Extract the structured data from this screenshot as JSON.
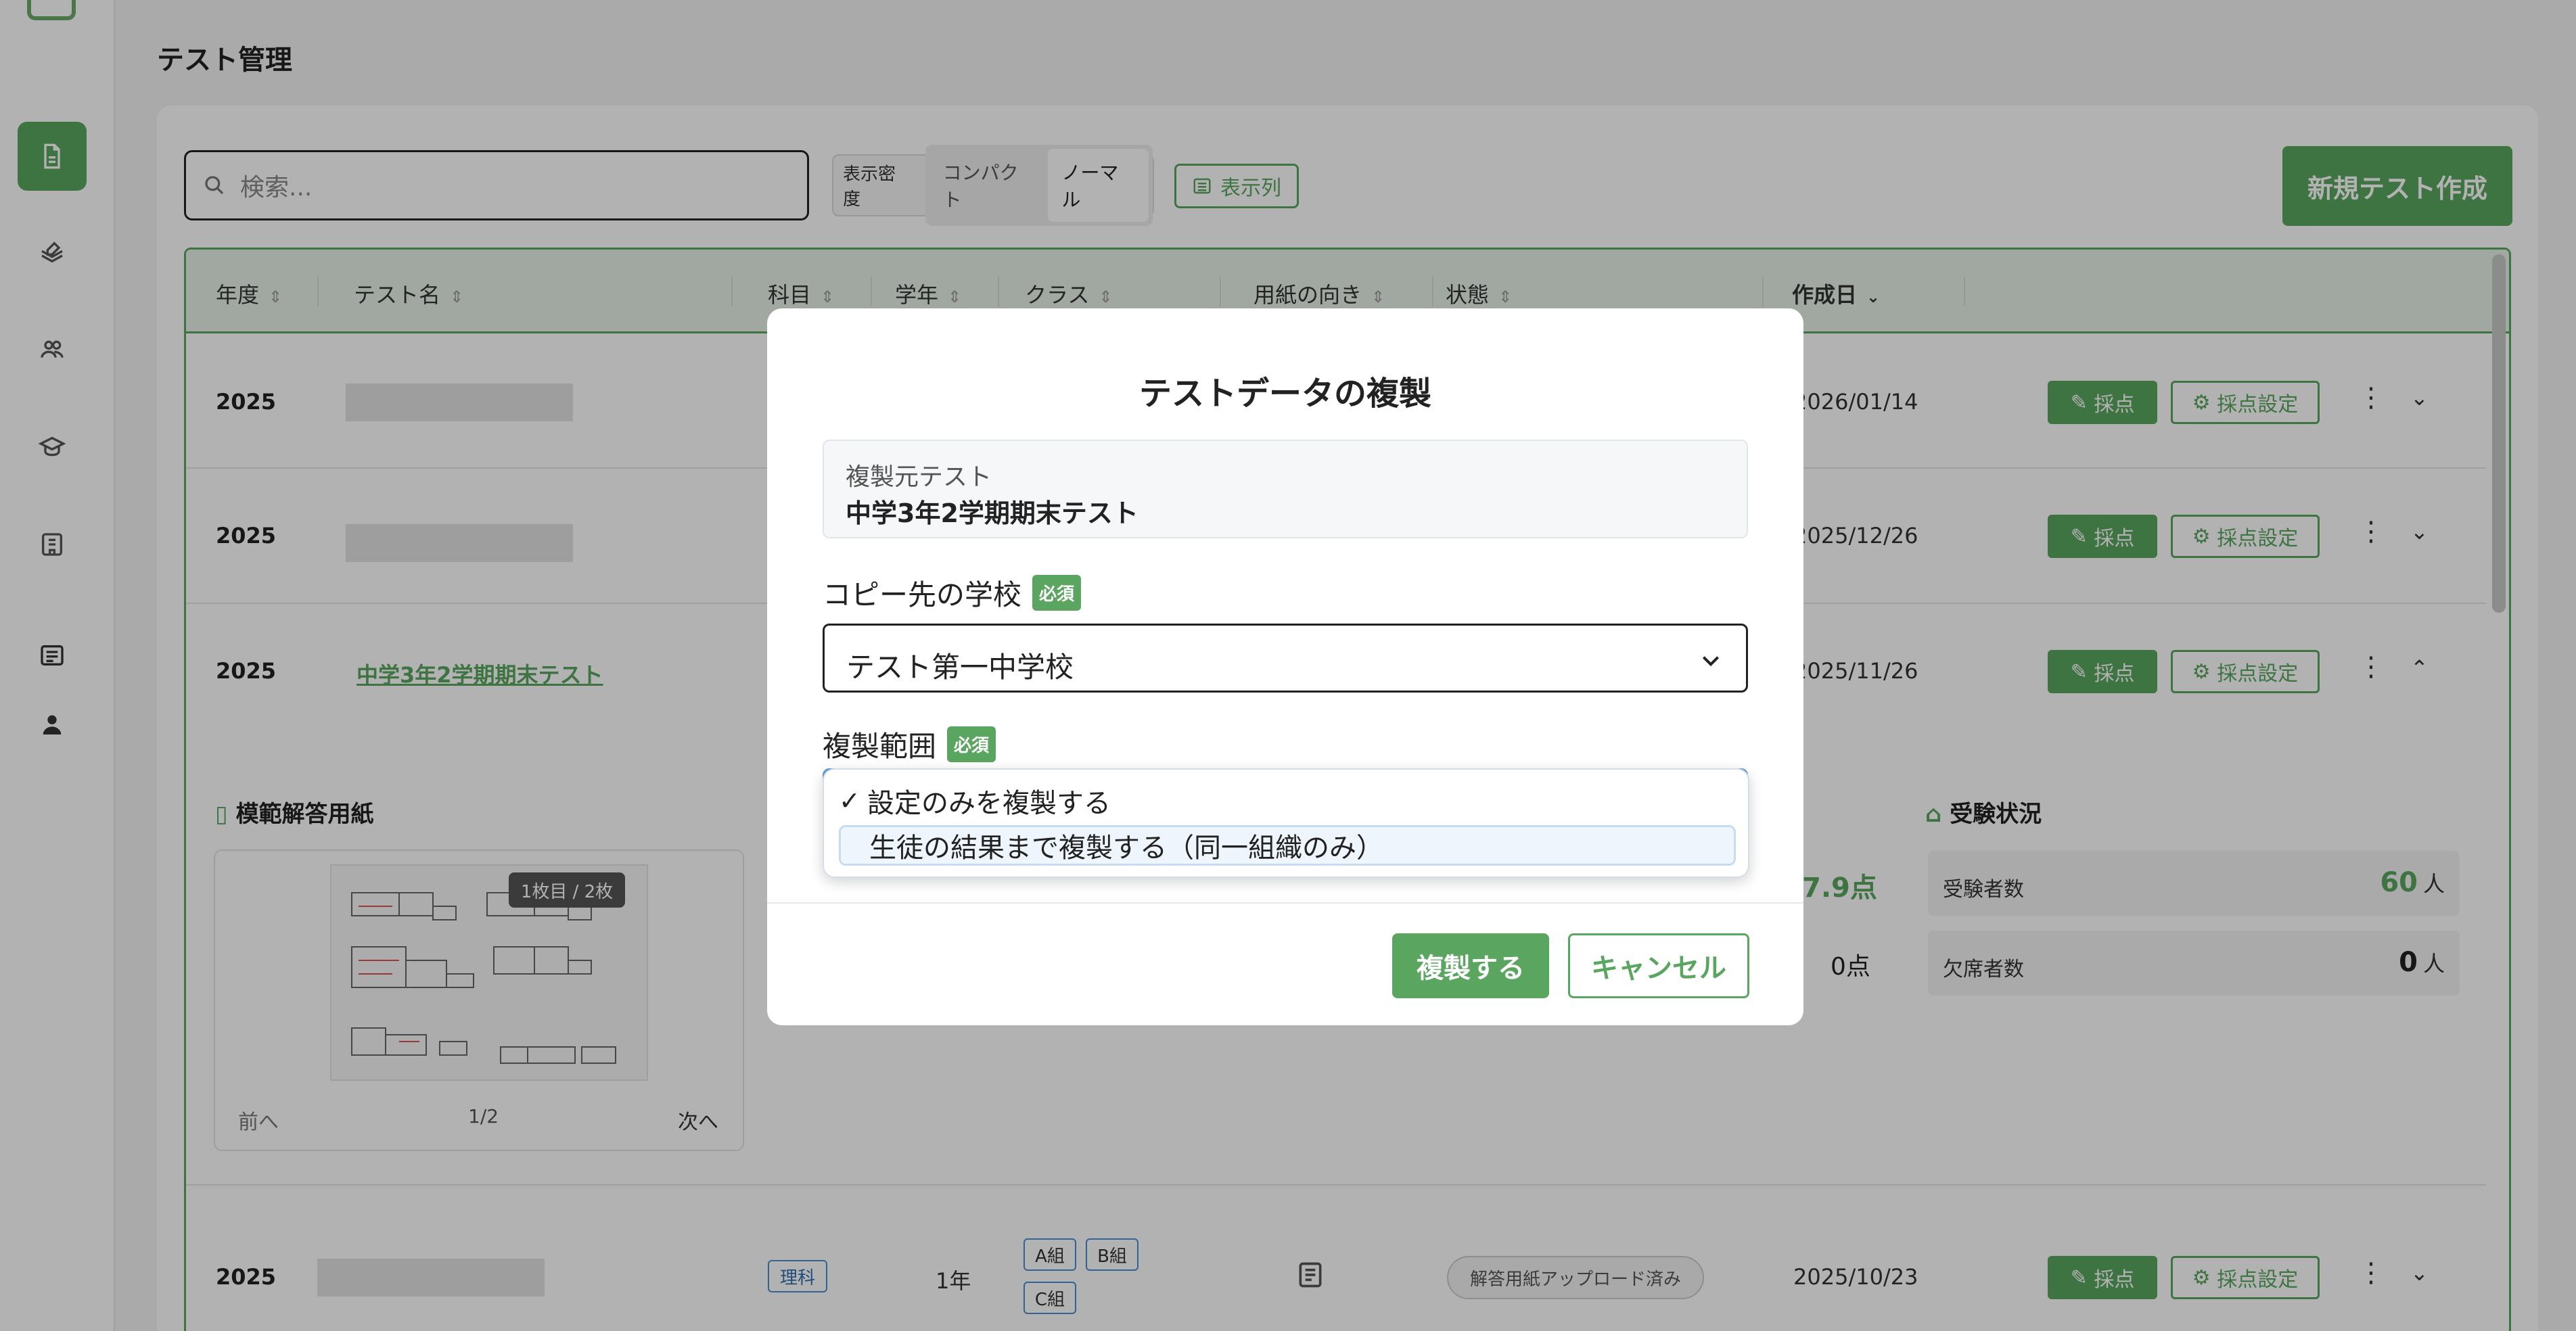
{
  "page": {
    "title": "テスト管理"
  },
  "toolbar": {
    "search_placeholder": "検索...",
    "density_label": "表示密度",
    "density_options": [
      "コンパクト",
      "ノーマル"
    ],
    "columns_label": "表示列",
    "new_test_label": "新規テスト作成"
  },
  "table": {
    "headers": [
      "年度",
      "テスト名",
      "科目",
      "学年",
      "クラス",
      "用紙の向き",
      "状態",
      "作成日"
    ],
    "rows": [
      {
        "year": "2025",
        "date": "2026/01/14"
      },
      {
        "year": "2025",
        "date": "2025/12/26"
      },
      {
        "year": "2025",
        "name": "中学3年2学期期末テスト",
        "date": "2025/11/26"
      },
      {
        "year": "2025",
        "subject": "理科",
        "grade": "1年",
        "classes": [
          "A組",
          "B組",
          "C組"
        ],
        "status": "解答用紙アップロード済み",
        "date": "2025/10/23"
      }
    ],
    "grade_label": "採点",
    "grade_settings_label": "採点設定"
  },
  "expanded": {
    "answer_sheet_title": "模範解答用紙",
    "page_badge": "1枚目 / 2枚",
    "prev": "前へ",
    "page_indicator": "1/2",
    "next": "次へ",
    "score_partial_1": "7.9点",
    "score_partial_2": "0点",
    "exam_status_title": "受験状況",
    "examinees_label": "受験者数",
    "examinees_value": "60",
    "absent_label": "欠席者数",
    "absent_value": "0",
    "unit_person": "人"
  },
  "modal": {
    "title": "テストデータの複製",
    "source_label": "複製元テスト",
    "source_name": "中学3年2学期期末テスト",
    "school_label": "コピー先の学校",
    "required": "必須",
    "school_value": "テスト第一中学校",
    "scope_label": "複製範囲",
    "scope_options": [
      {
        "label": "設定のみを複製する",
        "checked": true
      },
      {
        "label": "生徒の結果まで複製する（同一組織のみ）",
        "checked": false
      }
    ],
    "confirm": "複製する",
    "cancel": "キャンセル"
  },
  "colors": {
    "accent": "#5aa55f",
    "focus": "#5d9bd8"
  }
}
